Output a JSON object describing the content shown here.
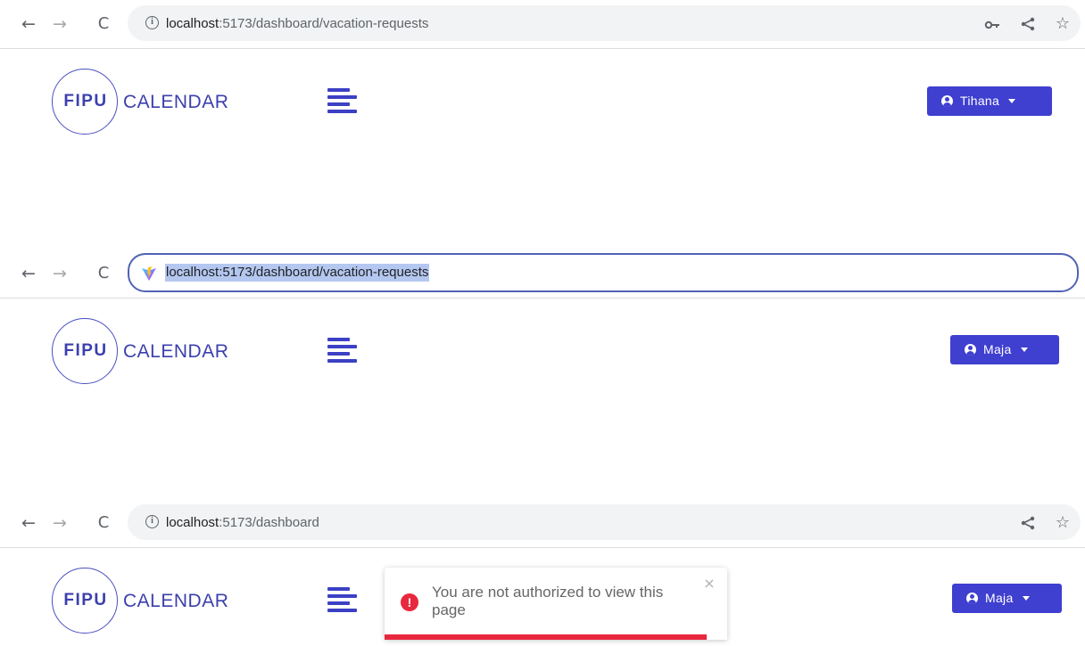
{
  "colors": {
    "brand": "#3c40ad",
    "user_button": "#3f3fd0",
    "error": "#e8283d",
    "focus_ring": "#5063b4",
    "url_selection": "#b4c7f0"
  },
  "icons": {
    "back": "←",
    "forward": "→",
    "reload": "C",
    "info": "i",
    "key": "o-",
    "share": "<",
    "star": "☆",
    "close": "×",
    "error": "!"
  },
  "logo": {
    "fipu": "FIPU",
    "calendar": "CALENDAR"
  },
  "panels": [
    {
      "url": {
        "host": "localhost",
        "path": ":5173/dashboard/vacation-requests"
      },
      "user": "Tihana"
    },
    {
      "url": {
        "full": "localhost:5173/dashboard/vacation-requests"
      },
      "user": "Maja"
    },
    {
      "url": {
        "host": "localhost",
        "path": ":5173/dashboard"
      },
      "user": "Maja"
    }
  ],
  "toast": {
    "message": "You are not authorized to view this page",
    "progress": 0.94
  }
}
